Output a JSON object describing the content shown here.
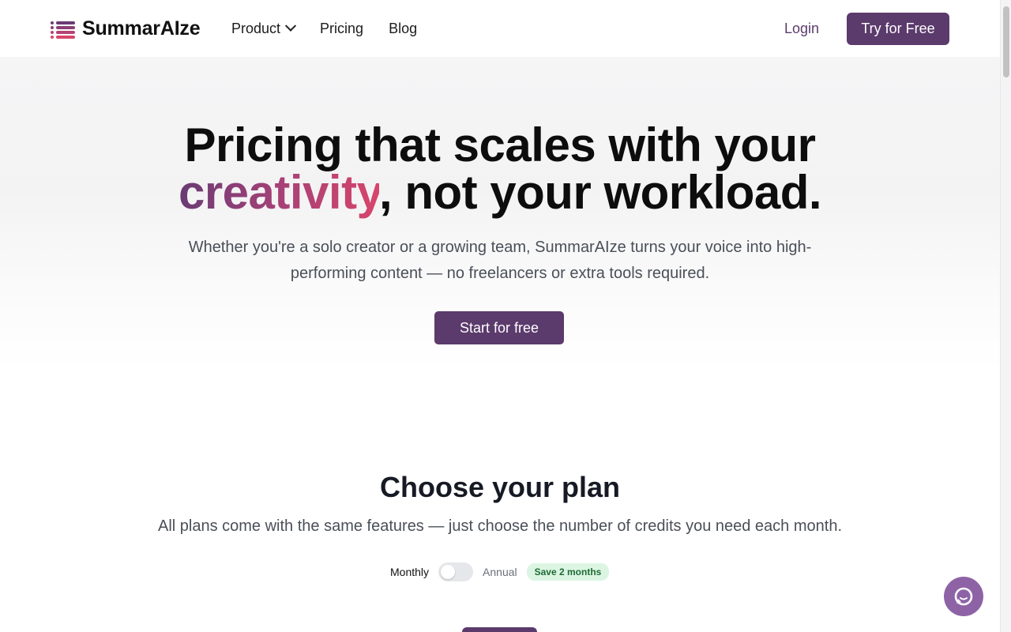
{
  "brand": {
    "name": "SummarAIze",
    "accent_color": "#5b3a6c",
    "icon": "list-bars-icon"
  },
  "nav": {
    "items": [
      {
        "label": "Product",
        "has_dropdown": true
      },
      {
        "label": "Pricing"
      },
      {
        "label": "Blog"
      }
    ],
    "login_label": "Login",
    "cta_label": "Try for Free"
  },
  "hero": {
    "title_line1": "Pricing that scales with your",
    "title_highlight": "creativity",
    "title_rest": ", not your workload.",
    "subtitle": "Whether you're a solo creator or a growing team, SummarAIze turns your voice into high-performing content — no freelancers or extra tools required.",
    "cta_label": "Start for free"
  },
  "plans": {
    "title": "Choose your plan",
    "subtitle": "All plans come with the same features — just choose the number of credits you need each month.",
    "billing_monthly": "Monthly",
    "billing_annual": "Annual",
    "save_badge": "Save 2 months",
    "annual_selected": false
  },
  "chat": {
    "icon": "chat-bubble-icon"
  }
}
